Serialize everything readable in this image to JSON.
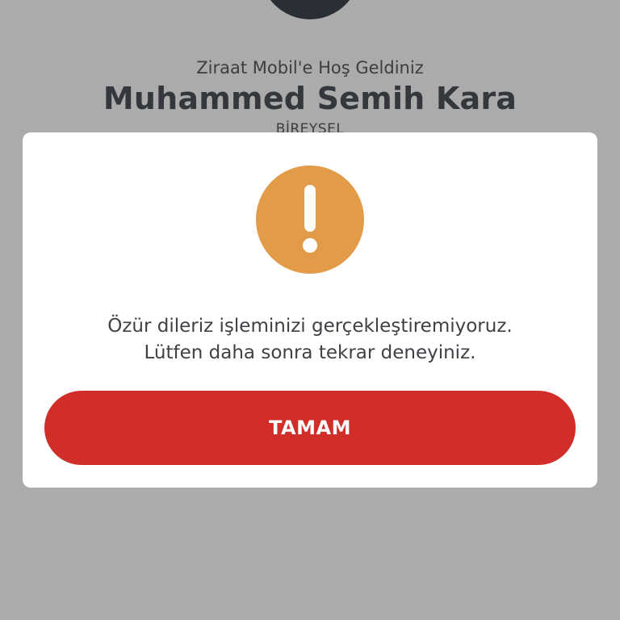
{
  "background": {
    "welcome_text": "Ziraat Mobil'e Hoş Geldiniz",
    "user_name": "Muhammed Semih Kara",
    "segment": "BİREYSEL"
  },
  "dialog": {
    "icon": "warning-exclamation-icon",
    "message_line1": "Özür dileriz işleminizi gerçekleştiremiyoruz.",
    "message_line2": "Lütfen daha sonra tekrar deneyiniz.",
    "ok_label": "TAMAM"
  },
  "colors": {
    "overlay_gray": "#ababab",
    "warning_orange": "#e29b49",
    "button_red": "#d12d29",
    "avatar_dark": "#2a2e35"
  }
}
